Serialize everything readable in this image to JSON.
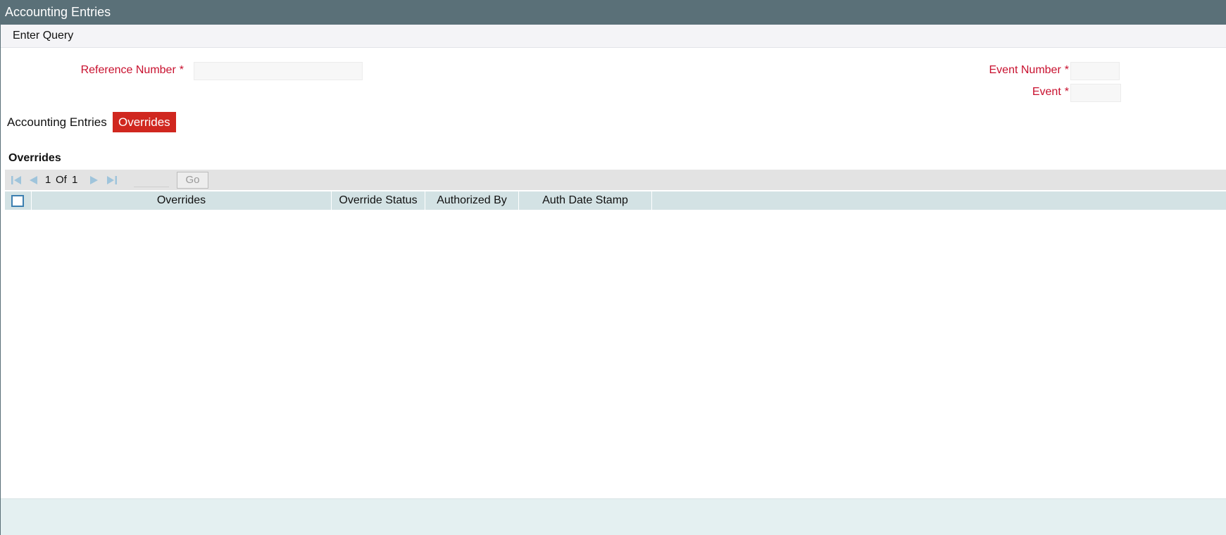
{
  "window": {
    "title": "Accounting Entries"
  },
  "toolbar": {
    "enter_query": "Enter Query"
  },
  "form": {
    "reference_number": {
      "label": "Reference Number",
      "required": "*",
      "value": ""
    },
    "event_number": {
      "label": "Event Number",
      "required": "*",
      "value": ""
    },
    "event": {
      "label": "Event",
      "required": "*",
      "value": ""
    }
  },
  "tabs": [
    {
      "label": "Accounting Entries",
      "active": false
    },
    {
      "label": "Overrides",
      "active": true
    }
  ],
  "section": {
    "title": "Overrides"
  },
  "pagination": {
    "current": "1",
    "of_label": "Of",
    "total": "1",
    "go_label": "Go",
    "page_input": ""
  },
  "table": {
    "columns": [
      "Overrides",
      "Override Status",
      "Authorized By",
      "Auth Date Stamp"
    ],
    "rows": []
  },
  "colors": {
    "title_bar": "#5a7078",
    "required_label": "#c8102e",
    "active_tab": "#d0271f",
    "table_header": "#d3e2e4",
    "nav_icon": "#9fc4db",
    "footer": "#e4f0f1"
  }
}
